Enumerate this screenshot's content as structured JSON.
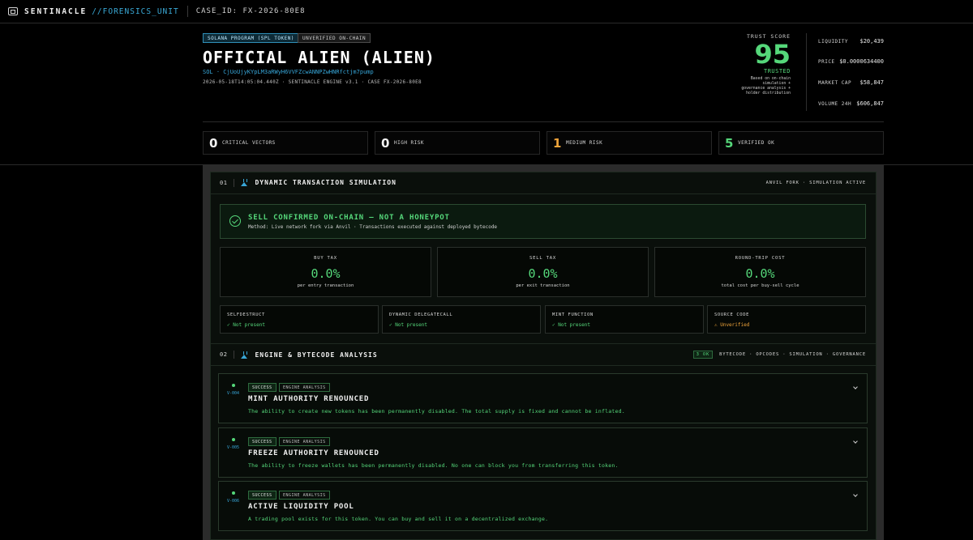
{
  "topbar": {
    "brand": "SENTINACLE",
    "brand_sub": "//FORENSICS_UNIT",
    "case_id": "CASE_ID: FX-2026-80E8"
  },
  "header": {
    "tag_program": "SOLANA PROGRAM (SPL TOKEN)",
    "tag_status": "UNVERIFIED ON-CHAIN",
    "title": "OFFICIAL ALIEN (ALIEN)",
    "address": "SOL · CjUoUjyKYpLM3aRWyH6VVFZcwANNPZwHNRfctjm7pump",
    "meta": "2026-05-18T14:05:04.440Z · SENTINACLE ENGINE v3.1 · CASE FX-2026-80E8"
  },
  "trust": {
    "label": "TRUST SCORE",
    "score": "95",
    "verdict": "TRUSTED",
    "desc_1": "Based on on-chain",
    "desc_2": "simulation +",
    "desc_3": "governance analysis +",
    "desc_4": "holder distribution"
  },
  "stats": {
    "liquidity_label": "LIQUIDITY",
    "liquidity_value": "$20,439",
    "price_label": "PRICE",
    "price_value": "$0.0000634400",
    "mcap_label": "MARKET CAP",
    "mcap_value": "$58,847",
    "volume_label": "VOLUME 24H",
    "volume_value": "$606,847"
  },
  "risk": [
    {
      "num": "0",
      "label": "CRITICAL VECTORS"
    },
    {
      "num": "0",
      "label": "HIGH RISK"
    },
    {
      "num": "1",
      "label": "MEDIUM RISK"
    },
    {
      "num": "5",
      "label": "VERIFIED OK"
    }
  ],
  "section1": {
    "num": "01",
    "title": "DYNAMIC TRANSACTION SIMULATION",
    "status": "ANVIL FORK · SIMULATION ACTIVE",
    "banner_title": "SELL CONFIRMED ON-CHAIN — NOT A HONEYPOT",
    "banner_sub": "Method: Live network fork via Anvil · Transactions executed against deployed bytecode",
    "taxes": [
      {
        "label": "BUY TAX",
        "value": "0.0%",
        "desc": "per entry transaction"
      },
      {
        "label": "SELL TAX",
        "value": "0.0%",
        "desc": "per exit transaction"
      },
      {
        "label": "ROUND-TRIP COST",
        "value": "0.0%",
        "desc": "total cost per buy-sell cycle"
      }
    ],
    "flags": [
      {
        "label": "SELFDESTRUCT",
        "value": "✓ Not present"
      },
      {
        "label": "DYNAMIC DELEGATECALL",
        "value": "✓ Not present"
      },
      {
        "label": "MINT FUNCTION",
        "value": "✓ Not present"
      },
      {
        "label": "SOURCE CODE",
        "value": "⚠ Unverified"
      }
    ]
  },
  "section2": {
    "num": "02",
    "title": "ENGINE & BYTECODE ANALYSIS",
    "ok_badge": "3 OK",
    "status": "BYTECODE · OPCODES · SIMULATION · GOVERNANCE",
    "findings": [
      {
        "id": "V-004",
        "badge1": "SUCCESS",
        "badge2": "ENGINE ANALYSIS",
        "title": "MINT AUTHORITY RENOUNCED",
        "desc": "The ability to create new tokens has been permanently disabled. The total supply is fixed and cannot be inflated."
      },
      {
        "id": "V-005",
        "badge1": "SUCCESS",
        "badge2": "ENGINE ANALYSIS",
        "title": "FREEZE AUTHORITY RENOUNCED",
        "desc": "The ability to freeze wallets has been permanently disabled. No one can block you from transferring this token."
      },
      {
        "id": "V-006",
        "badge1": "SUCCESS",
        "badge2": "ENGINE ANALYSIS",
        "title": "ACTIVE LIQUIDITY POOL",
        "desc": "A trading pool exists for this token. You can buy and sell it on a decentralized exchange."
      }
    ]
  },
  "colors": {
    "accent_green": "#55d77a",
    "accent_blue": "#37a6d8",
    "warning_orange": "#f0a43a"
  }
}
